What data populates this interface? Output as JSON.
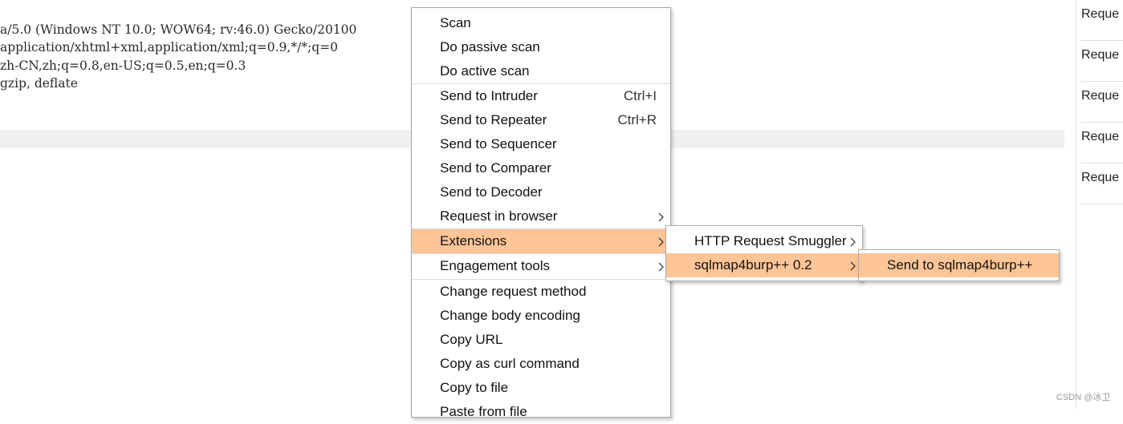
{
  "editor": {
    "lines": [
      "a/5.0 (Windows NT 10.0; WOW64; rv:46.0) Gecko/20100",
      " application/xhtml+xml,application/xml;q=0.9,*/*;q=0",
      "zh-CN,zh;q=0.8,en-US;q=0.5,en;q=0.3",
      "gzip, deflate"
    ]
  },
  "side_panel": {
    "items": [
      "Reque",
      "Reque",
      "Reque",
      "Reque",
      "Reque"
    ]
  },
  "context_menu": {
    "items": [
      {
        "label": "Scan"
      },
      {
        "label": "Do passive scan"
      },
      {
        "label": "Do active scan"
      },
      {
        "label": "Send to Intruder",
        "shortcut": "Ctrl+I"
      },
      {
        "label": "Send to Repeater",
        "shortcut": "Ctrl+R"
      },
      {
        "label": "Send to Sequencer"
      },
      {
        "label": "Send to Comparer"
      },
      {
        "label": "Send to Decoder"
      },
      {
        "label": "Request in browser",
        "submenu_arrow": "chevron-right-icon"
      },
      {
        "label": "Extensions",
        "submenu_arrow": "chevron-right-icon",
        "highlighted": true
      },
      {
        "label": "Engagement tools",
        "submenu_arrow": "chevron-right-icon"
      },
      {
        "label": "Change request method"
      },
      {
        "label": "Change body encoding"
      },
      {
        "label": "Copy URL"
      },
      {
        "label": "Copy as curl command"
      },
      {
        "label": "Copy to file"
      },
      {
        "label": "Paste from file"
      }
    ]
  },
  "extensions_submenu": {
    "items": [
      {
        "label": "HTTP Request Smuggler",
        "submenu_arrow": "chevron-right-icon"
      },
      {
        "label": "sqlmap4burp++ 0.2",
        "submenu_arrow": "chevron-right-icon",
        "highlighted": true
      }
    ]
  },
  "sqlmap_submenu": {
    "items": [
      {
        "label": "Send to sqlmap4burp++",
        "highlighted": true
      }
    ]
  },
  "watermark": "CSDN @冰卫",
  "colors": {
    "highlight": "#ffc596",
    "menu_border": "#a9a9a9",
    "row_highlight": "#f0f0f0"
  }
}
